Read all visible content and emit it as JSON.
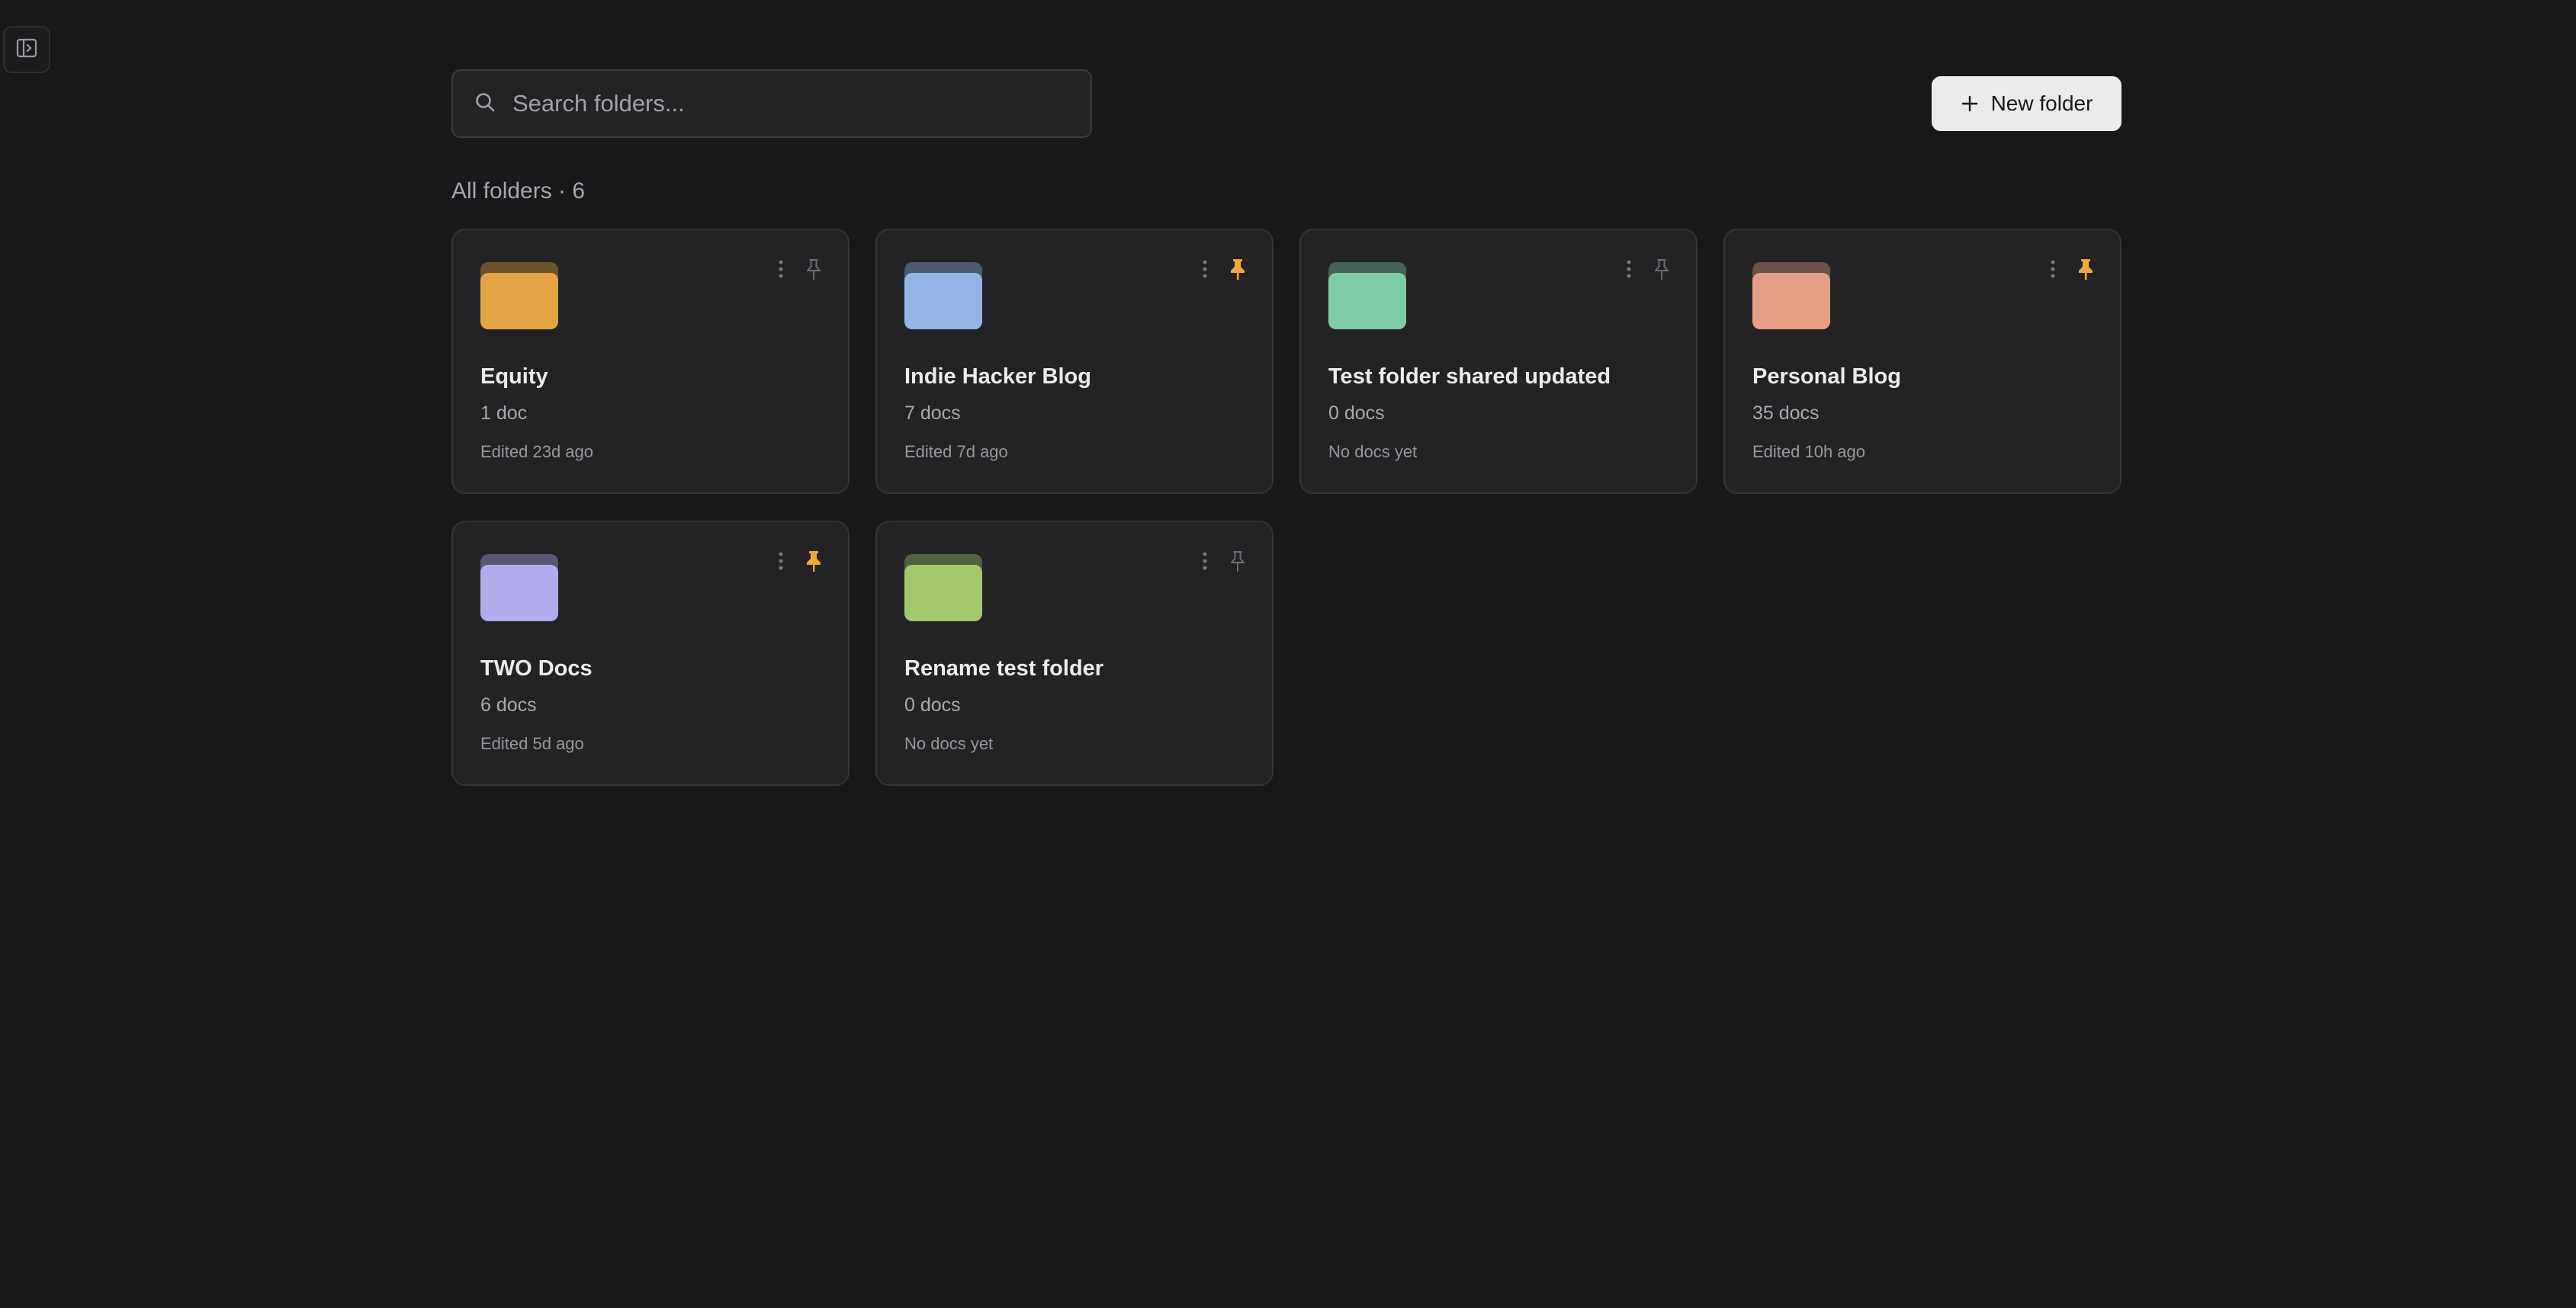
{
  "sidebar_toggle": {
    "icon": "sidebar-toggle-icon"
  },
  "search": {
    "placeholder": "Search folders...",
    "value": ""
  },
  "toolbar": {
    "new_folder_label": "New folder"
  },
  "heading": {
    "text": "All folders · 6"
  },
  "folders": [
    {
      "name": "Equity",
      "count": "1 doc",
      "edited": "Edited 23d ago",
      "color": "#e5a444",
      "pinned": false
    },
    {
      "name": "Indie Hacker Blog",
      "count": "7 docs",
      "edited": "Edited 7d ago",
      "color": "#93b5e6",
      "pinned": true
    },
    {
      "name": "Test folder shared updated",
      "count": "0 docs",
      "edited": "No docs yet",
      "color": "#7ecba7",
      "pinned": false
    },
    {
      "name": "Personal Blog",
      "count": "35 docs",
      "edited": "Edited 10h ago",
      "color": "#e69e86",
      "pinned": true
    },
    {
      "name": "TWO Docs",
      "count": "6 docs",
      "edited": "Edited 5d ago",
      "color": "#b1acec",
      "pinned": true
    },
    {
      "name": "Rename test folder",
      "count": "0 docs",
      "edited": "No docs yet",
      "color": "#a2c86b",
      "pinned": false
    }
  ],
  "colors": {
    "background": "#18181a",
    "card": "#232325",
    "pin_active": "#f0a836",
    "pin_inactive": "#6e6e72"
  }
}
